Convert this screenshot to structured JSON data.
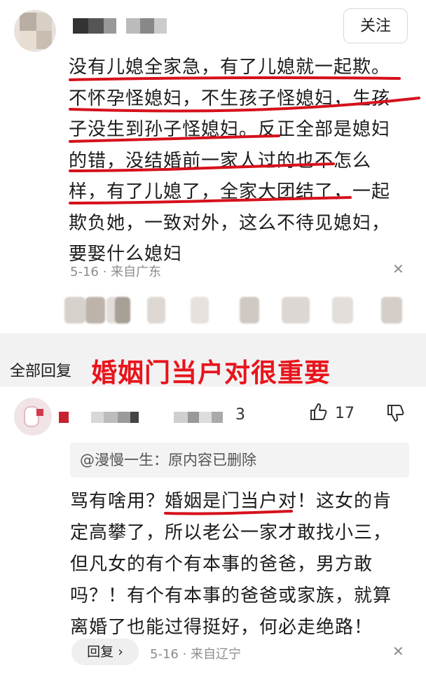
{
  "header": {
    "follow_label": "关注"
  },
  "comment": {
    "text": "没有儿媳全家急，有了儿媳就一起欺。不怀孕怪媳妇，不生孩子怪媳妇，生孩子没生到孙子怪媳妇。反正全部是媳妇的错，没结婚前一家人过的也不怎么样，有了儿媳了，全家大团结了，一起欺负她，一致对外，这么不待见媳妇，要娶什么媳妇",
    "lines": [
      "没有儿媳全家急，有了儿媳就一起欺。",
      "不怀孕怪媳妇，不生孩子怪媳妇，生孩",
      "子没生到孙子怪媳妇。反正全部是媳妇",
      "的错，没结婚前一家人过的也不怎么",
      "样，有了儿媳了，全家大团结了，一起",
      "欺负她，一致对外，这么不待见媳妇，",
      "要娶什么媳妇"
    ],
    "meta": "5-16 · 来自广东",
    "close_glyph": "✕"
  },
  "replies_section": {
    "label": "全部回复",
    "headline": "婚姻门当户对很重要"
  },
  "reply": {
    "reply_count": "3",
    "like_count": "17",
    "quote": "@漫慢一生：原内容已删除",
    "lines": [
      "骂有啥用？婚姻是门当户对！这女的肯",
      "定高攀了，所以老公一家才敢找小三，",
      "但凡女的有个有本事的爸爸，男方敢",
      "吗？！有个有本事的爸爸或家族，就算",
      "离婚了也能过得挺好，何必走绝路！"
    ],
    "reply_button": "回复 ›",
    "meta": "5-16 · 来自辽宁",
    "close_glyph": "✕"
  },
  "colors": {
    "underline": "#d6111c",
    "headline": "#e8141c",
    "meta": "#8c8c8c"
  },
  "icons": [
    "thumbs-up-icon",
    "thumbs-down-icon",
    "close-icon"
  ]
}
